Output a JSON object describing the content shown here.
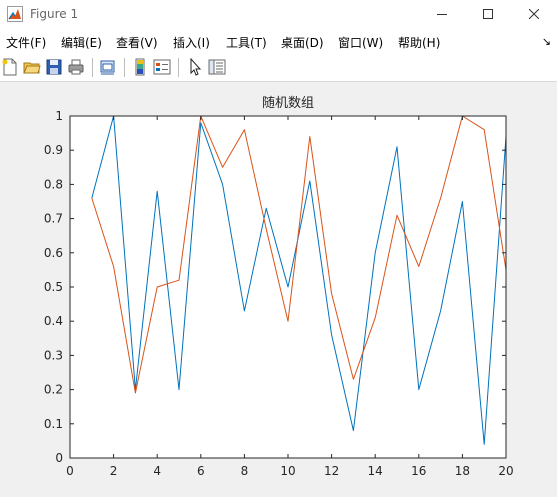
{
  "window": {
    "title": "Figure 1",
    "controls": [
      "minimize",
      "maximize",
      "close"
    ]
  },
  "menubar": {
    "items": [
      "文件(F)",
      "编辑(E)",
      "查看(V)",
      "插入(I)",
      "工具(T)",
      "桌面(D)",
      "窗口(W)",
      "帮助(H)"
    ],
    "overflow_icon": "chevron-double-right-icon"
  },
  "toolbar": {
    "buttons": [
      "new-figure-icon",
      "open-file-icon",
      "save-icon",
      "print-icon",
      "print-preview-icon",
      "colorbar-icon",
      "legend-icon",
      "pointer-icon",
      "property-inspector-icon"
    ]
  },
  "colors": {
    "series1": "#0072BD",
    "series2": "#D95319",
    "axes_bg": "#ffffff",
    "figure_bg": "#f0f0f0"
  },
  "chart_data": {
    "type": "line",
    "title": "随机数组",
    "xlabel": "",
    "ylabel": "",
    "xlim": [
      0,
      20
    ],
    "ylim": [
      0,
      1
    ],
    "xticks": [
      0,
      2,
      4,
      6,
      8,
      10,
      12,
      14,
      16,
      18,
      20
    ],
    "yticks": [
      0,
      0.1,
      0.2,
      0.3,
      0.4,
      0.5,
      0.6,
      0.7,
      0.8,
      0.9,
      1
    ],
    "grid": false,
    "legend": "none",
    "x": [
      1,
      2,
      3,
      4,
      5,
      6,
      7,
      8,
      9,
      10,
      11,
      12,
      13,
      14,
      15,
      16,
      17,
      18,
      19,
      20
    ],
    "series": [
      {
        "color": "#0072BD",
        "values": [
          0.76,
          1.0,
          0.2,
          0.78,
          0.2,
          0.98,
          0.8,
          0.43,
          0.73,
          0.5,
          0.81,
          0.36,
          0.08,
          0.6,
          0.91,
          0.2,
          0.43,
          0.75,
          0.04,
          0.94
        ]
      },
      {
        "color": "#D95319",
        "values": [
          0.76,
          0.56,
          0.19,
          0.5,
          0.52,
          1.0,
          0.85,
          0.96,
          0.67,
          0.4,
          0.94,
          0.48,
          0.23,
          0.41,
          0.71,
          0.56,
          0.76,
          1.0,
          0.96,
          0.55
        ]
      }
    ]
  }
}
